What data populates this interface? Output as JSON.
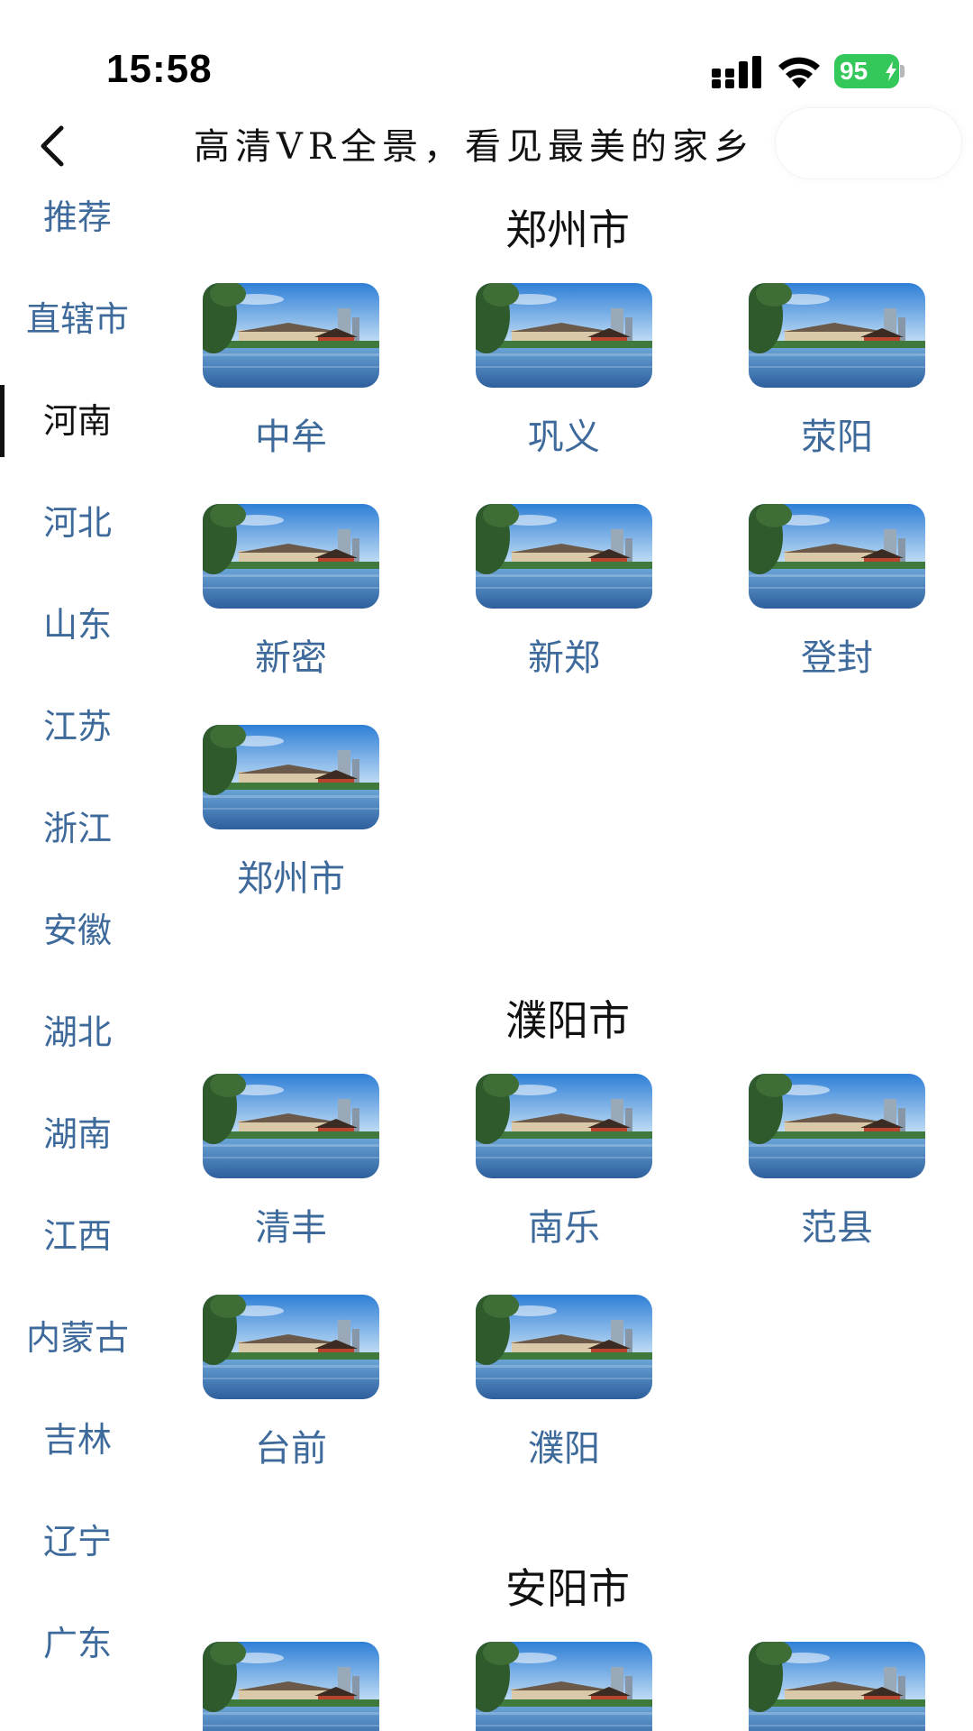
{
  "status_bar": {
    "time": "15:58",
    "battery": "95",
    "icons": [
      "cellular-signal-icon",
      "wifi-icon",
      "battery-charging-icon"
    ]
  },
  "nav": {
    "back_icon": "chevron-left-icon",
    "title": "高清VR全景，看见最美的家乡"
  },
  "sidebar": {
    "active_index": 2,
    "items": [
      "推荐",
      "直辖市",
      "河南",
      "河北",
      "山东",
      "江苏",
      "浙江",
      "安徽",
      "湖北",
      "湖南",
      "江西",
      "内蒙古",
      "吉林",
      "辽宁",
      "广东"
    ]
  },
  "sections": [
    {
      "title": "郑州市",
      "cities": [
        "中牟",
        "巩义",
        "荥阳",
        "新密",
        "新郑",
        "登封",
        "郑州市"
      ]
    },
    {
      "title": "濮阳市",
      "cities": [
        "清丰",
        "南乐",
        "范县",
        "台前",
        "濮阳"
      ]
    },
    {
      "title": "安阳市",
      "cities": [
        "",
        "",
        ""
      ]
    }
  ],
  "colors": {
    "link_blue": "#3e6a9b",
    "battery_green": "#34c759",
    "text_dark": "#111111"
  }
}
